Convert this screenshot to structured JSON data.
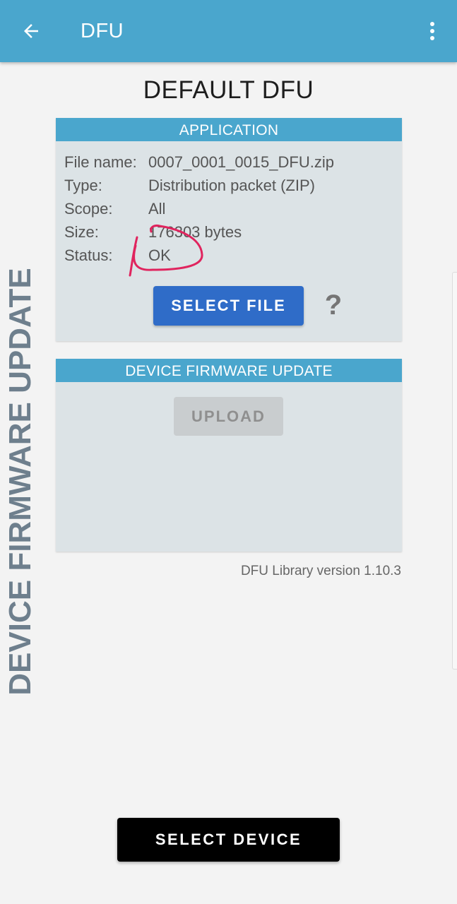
{
  "appbar": {
    "title": "DFU",
    "back_icon": "arrow-back-icon",
    "menu_icon": "more-vert-icon",
    "color": "#4aa6cd"
  },
  "heading": "DEFAULT DFU",
  "side_label": "DEVICE FIRMWARE UPDATE",
  "application": {
    "header": "APPLICATION",
    "rows": [
      {
        "label": "File name:",
        "value": "0007_0001_0015_DFU.zip"
      },
      {
        "label": "Type:",
        "value": "Distribution packet (ZIP)"
      },
      {
        "label": "Scope:",
        "value": "All"
      },
      {
        "label": "Size:",
        "value": "176303 bytes"
      },
      {
        "label": "Status:",
        "value": "OK"
      }
    ],
    "select_file_label": "SELECT FILE",
    "help_label": "?",
    "annotation_color": "#e0245e"
  },
  "dfu": {
    "header": "DEVICE FIRMWARE UPDATE",
    "upload_label": "UPLOAD"
  },
  "version": "DFU Library version 1.10.3",
  "select_device_label": "SELECT DEVICE",
  "colors": {
    "accent": "#4aa6cd",
    "primary_button": "#2f6cc8",
    "card_bg": "#dce3e6",
    "side_label": "#6e7f8d"
  }
}
